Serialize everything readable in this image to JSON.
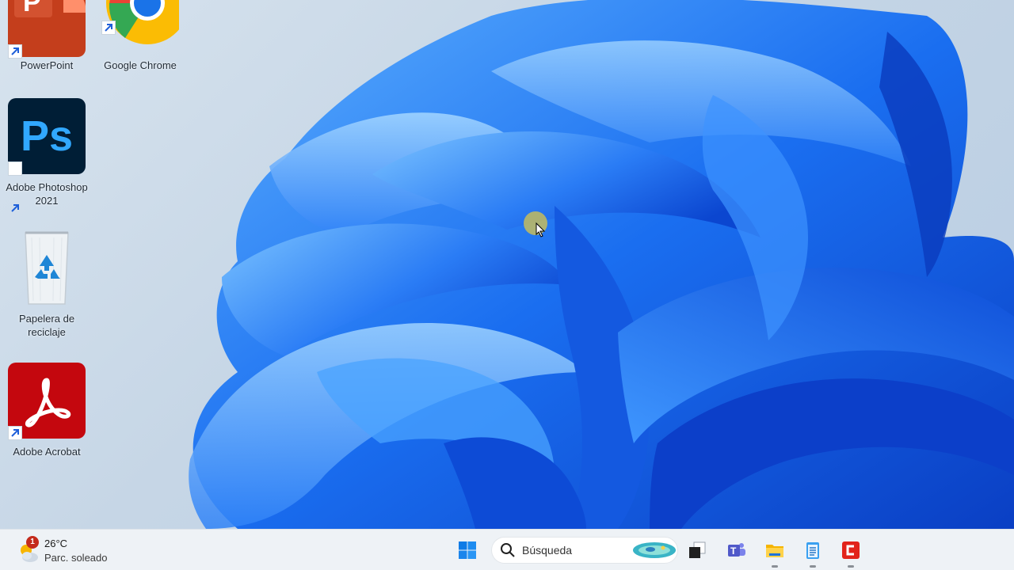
{
  "desktop": {
    "icons": [
      {
        "label": "PowerPoint"
      },
      {
        "label": "Google Chrome"
      },
      {
        "label": "Adobe Photoshop 2021",
        "glyph": "Ps"
      },
      {
        "label": "Papelera de reciclaje"
      },
      {
        "label": "Adobe Acrobat"
      }
    ]
  },
  "taskbar": {
    "weather": {
      "temperature": "26°C",
      "condition": "Parc. soleado",
      "badge_count": "1"
    },
    "search": {
      "placeholder": "Búsqueda"
    },
    "apps": [
      {
        "icon": "start-icon"
      },
      {
        "icon": "search-icon"
      },
      {
        "icon": "search-highlight-icon"
      },
      {
        "icon": "task-view-icon"
      },
      {
        "icon": "teams-icon"
      },
      {
        "icon": "file-explorer-icon",
        "running": true
      },
      {
        "icon": "notepad-icon",
        "running": true
      },
      {
        "icon": "camtasia-icon",
        "running": true
      }
    ]
  },
  "colors": {
    "accent": "#0067c0",
    "wallpaper_blue": "#1e6ff0",
    "taskbar_bg": "#eef2f6"
  }
}
